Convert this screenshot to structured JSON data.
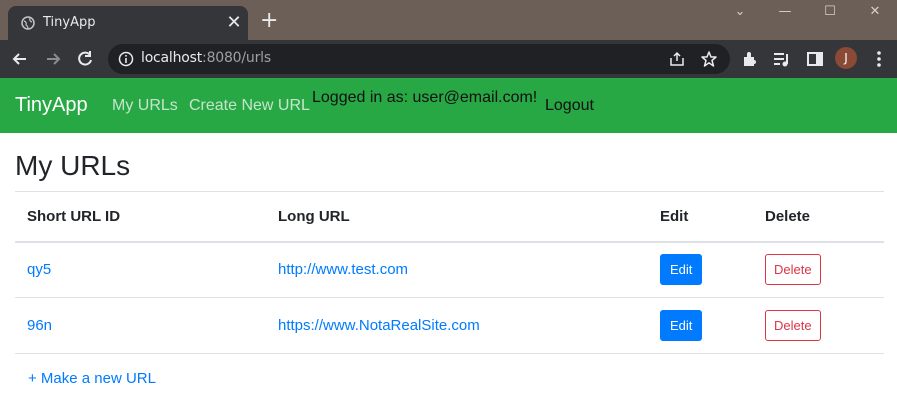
{
  "browser": {
    "tab_title": "TinyApp",
    "tab_close": "✕",
    "new_tab": "+",
    "url_host": "localhost",
    "url_rest": ":8080/urls",
    "window_controls": [
      "⌄",
      "—",
      "☐",
      "✕"
    ],
    "avatar_initial": "J",
    "colors": {
      "tabstrip": "#6b5f58",
      "toolbar": "#35363a",
      "omnibox": "#202124",
      "avatar": "#8a4a36"
    }
  },
  "navbar": {
    "brand": "TinyApp",
    "links": [
      "My URLs",
      "Create New URL"
    ],
    "logged_in": "Logged in as: user@email.com!",
    "logout": "Logout",
    "color": "#28a745"
  },
  "page": {
    "title": "My URLs",
    "columns": [
      "Short URL ID",
      "Long URL",
      "Edit",
      "Delete"
    ],
    "rows": [
      {
        "short_id": "qy5",
        "long_url": "http://www.test.com",
        "edit": "Edit",
        "delete": "Delete"
      },
      {
        "short_id": "96n",
        "long_url": "https://www.NotaRealSite.com",
        "edit": "Edit",
        "delete": "Delete"
      }
    ],
    "make_new": "+ Make a new URL",
    "colors": {
      "link": "#007bff",
      "edit_button": "#007bff",
      "delete_button": "#dc3545"
    }
  }
}
